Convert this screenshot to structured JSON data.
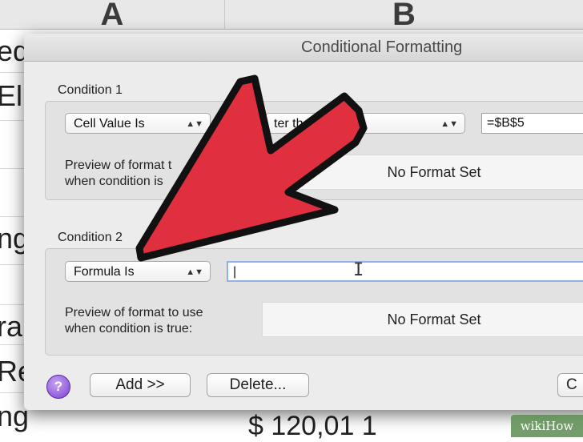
{
  "spreadsheet": {
    "column_headers": [
      "A",
      "B"
    ],
    "cell_fragments": [
      "ed",
      "El",
      "ng",
      "ra",
      "Re",
      "ng"
    ],
    "bottom_fragment": "$ 120,01 1"
  },
  "dialog": {
    "title": "Conditional Formatting",
    "condition1": {
      "label": "Condition 1",
      "type_value": "Cell Value Is",
      "operator_value": "ter th",
      "formula_value": "=$B$5",
      "preview_label_line1": "Preview of format t",
      "preview_label_line2": "when condition is",
      "preview_text": "No Format Set"
    },
    "condition2": {
      "label": "Condition 2",
      "type_value": "Formula Is",
      "formula_value": "|",
      "preview_label_line1": "Preview of format to use",
      "preview_label_line2": "when condition is true:",
      "preview_text": "No Format Set"
    },
    "buttons": {
      "help": "?",
      "add": "Add >>",
      "delete": "Delete...",
      "cancel_partial": "C"
    }
  },
  "watermark": "wikiHow",
  "colors": {
    "arrow_fill": "#e03040",
    "arrow_stroke": "#111111"
  }
}
